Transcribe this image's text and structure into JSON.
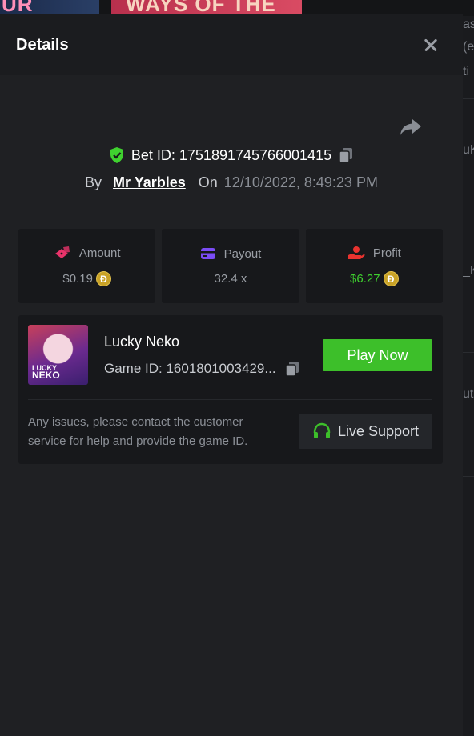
{
  "background": {
    "thumb1_text": "UR",
    "thumb2_text": "WAYS OF THE",
    "code_fragments": [
      "as",
      "(e",
      "ti",
      "uK",
      "_K",
      "ut"
    ]
  },
  "panel": {
    "title": "Details",
    "close_icon": "close-icon",
    "share_icon": "share-icon"
  },
  "bet": {
    "id_label": "Bet ID: 1751891745766001415",
    "by_label": "By",
    "user": "Mr Yarbles",
    "on_label": "On",
    "date": "12/10/2022, 8:49:23 PM"
  },
  "stats": [
    {
      "label": "Amount",
      "value": "$0.19",
      "icon": "dice-icon",
      "coin": "Ð"
    },
    {
      "label": "Payout",
      "value": "32.4 x",
      "icon": "card-icon"
    },
    {
      "label": "Profit",
      "value": "$6.27",
      "icon": "hand-coin-icon",
      "coin": "Ð"
    }
  ],
  "game": {
    "name": "Lucky Neko",
    "id": "Game ID: 1601801003429...",
    "thumb_line1": "LUCKY",
    "thumb_line2": "NEKO",
    "play_label": "Play Now",
    "support_text": "Any issues, please contact the customer service for help and provide the game ID.",
    "support_label": "Live Support"
  },
  "colors": {
    "accent_green": "#3dbf2a",
    "profit_green": "#3fd12f",
    "amount_icon": "#e8336a",
    "payout_icon": "#7b4cf5",
    "profit_icon": "#e8332f",
    "coin": "#c9a227"
  }
}
